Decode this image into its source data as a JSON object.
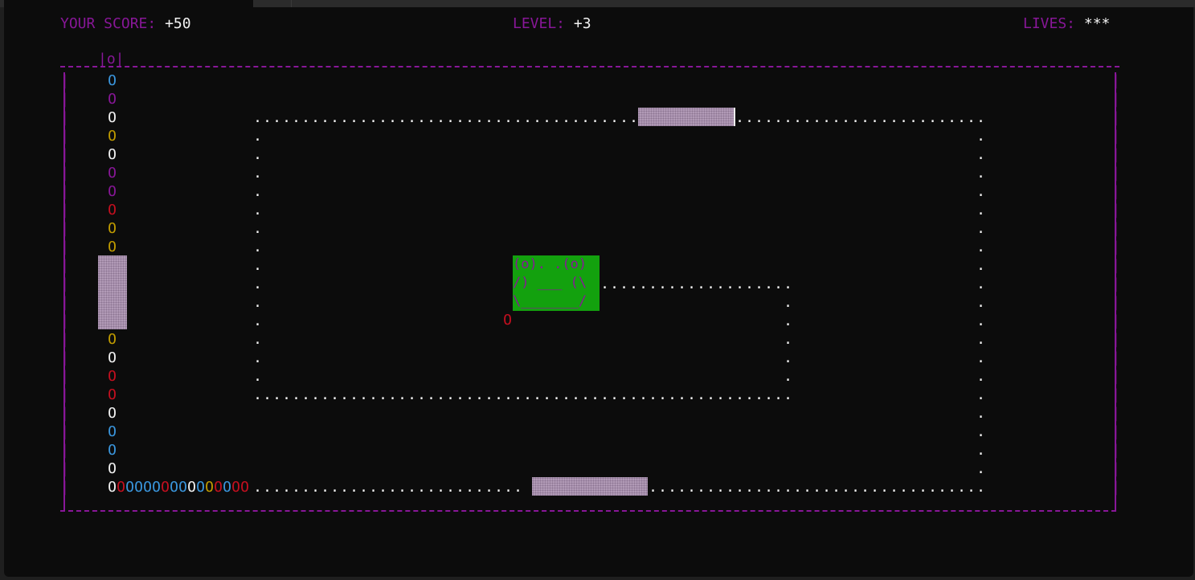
{
  "window": {
    "tab_color": "#0c0c0c",
    "background": "#0c0c0c"
  },
  "hud": {
    "score_label": "YOUR SCORE:",
    "score_value": "+50",
    "level_label": "LEVEL:",
    "level_value": "+3",
    "lives_label": "LIVES:",
    "lives_value": "***"
  },
  "board": {
    "gate": "|o|",
    "border_color": "#881798",
    "dot_glyph": ".",
    "wall_glyph": "|"
  },
  "monster": {
    "lines": [
      "(o). .(o)",
      "/) ___ (\\",
      "\\_______/"
    ],
    "bg_color": "#13a10e",
    "fg_color": "#881798"
  },
  "ball": {
    "glyph": "O",
    "color": "#c50f1f"
  },
  "snake": {
    "glyph": "O",
    "vertical_colors": [
      "#3a96dd",
      "#881798",
      "#f2f2f2",
      "#c19c00",
      "#f2f2f2",
      "#881798",
      "#881798",
      "#c50f1f",
      "#c19c00",
      "#c19c00"
    ],
    "vertical_colors_lower": [
      "#c19c00",
      "#f2f2f2",
      "#c50f1f",
      "#c50f1f",
      "#f2f2f2",
      "#3a96dd",
      "#3a96dd",
      "#f2f2f2"
    ],
    "horizontal_colors": [
      "#f2f2f2",
      "#c50f1f",
      "#3a96dd",
      "#3a96dd",
      "#3a96dd",
      "#3a96dd",
      "#c50f1f",
      "#3a96dd",
      "#3a96dd",
      "#f2f2f2",
      "#3a96dd",
      "#c19c00",
      "#c50f1f",
      "#3a96dd",
      "#c50f1f",
      "#c50f1f"
    ]
  },
  "colors": {
    "paddle": "#b19ab6",
    "text": "#f2f2f2",
    "accent": "#881798"
  }
}
